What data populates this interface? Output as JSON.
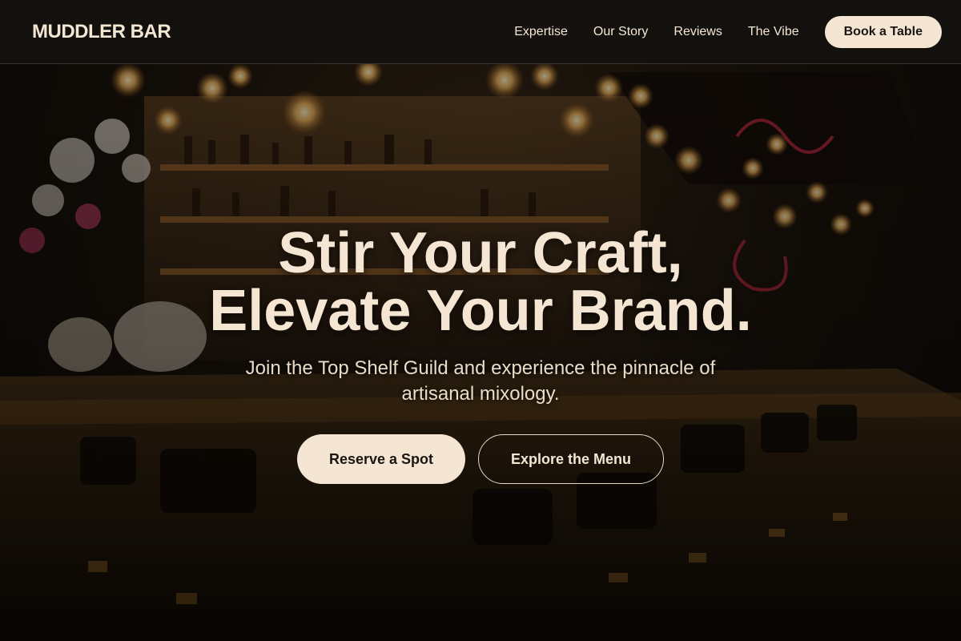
{
  "header": {
    "logo": "MUDDLER BAR",
    "nav": [
      {
        "label": "Expertise"
      },
      {
        "label": "Our Story"
      },
      {
        "label": "Reviews"
      },
      {
        "label": "The Vibe"
      }
    ],
    "cta_label": "Book a Table"
  },
  "hero": {
    "title_line1": "Stir Your Craft,",
    "title_line2": "Elevate Your Brand.",
    "subtitle": "Join the Top Shelf Guild and experience the pinnacle of artisanal mixology.",
    "primary_cta": "Reserve a Spot",
    "secondary_cta": "Explore the Menu",
    "background": "bar-interior-photo"
  },
  "colors": {
    "accent_cream": "#f5e6d3",
    "header_bg": "#14120f",
    "text_dark": "#1a1612"
  }
}
